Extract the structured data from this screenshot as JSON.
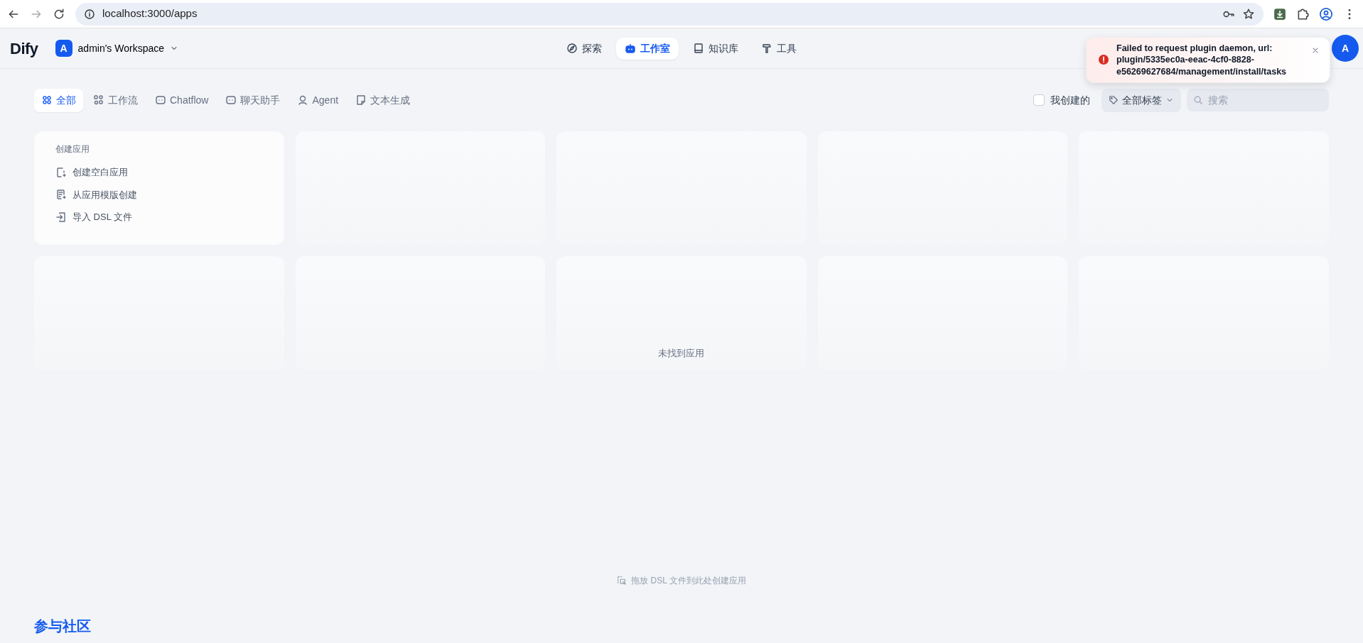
{
  "browser": {
    "url": "localhost:3000/apps"
  },
  "header": {
    "logo": "Dify",
    "workspace": {
      "initial": "A",
      "name": "admin's Workspace"
    },
    "nav": [
      {
        "label": "探索",
        "selected": false
      },
      {
        "label": "工作室",
        "selected": true
      },
      {
        "label": "知识库",
        "selected": false
      },
      {
        "label": "工具",
        "selected": false
      }
    ],
    "avatar": "A"
  },
  "filters": [
    {
      "label": "全部",
      "selected": true
    },
    {
      "label": "工作流",
      "selected": false
    },
    {
      "label": "Chatflow",
      "selected": false
    },
    {
      "label": "聊天助手",
      "selected": false
    },
    {
      "label": "Agent",
      "selected": false
    },
    {
      "label": "文本生成",
      "selected": false
    }
  ],
  "mine": {
    "label": "我创建的",
    "checked": false
  },
  "tags": {
    "label": "全部标签"
  },
  "search": {
    "placeholder": "搜索"
  },
  "create_card": {
    "title": "创建应用",
    "actions": [
      "创建空白应用",
      "从应用模版创建",
      "导入 DSL 文件"
    ]
  },
  "empty_message": "未找到应用",
  "drop_hint": "拖放 DSL 文件到此处创建应用",
  "community": {
    "title": "参与社区"
  },
  "toast": {
    "kind": "error",
    "message": "Failed to request plugin daemon, url: plugin/5335ec0a-eeac-4cf0-8828-e56269627684/management/install/tasks"
  }
}
